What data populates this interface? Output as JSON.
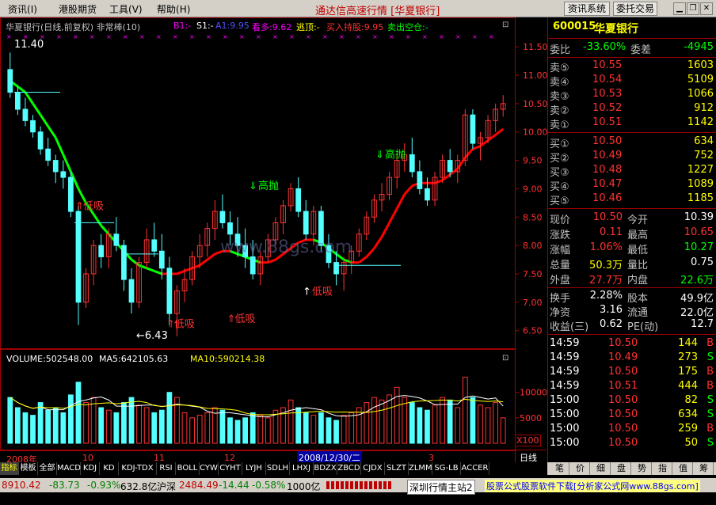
{
  "menu": {
    "items": [
      "资讯",
      "港股期货",
      "工具",
      "帮助"
    ],
    "hotkeys": [
      "(I)",
      "",
      "(V)",
      "(H)"
    ],
    "app_title": "通达信高速行情 [华夏银行]",
    "btn_news": "资讯系统",
    "btn_trade": "委托交易"
  },
  "legend": {
    "title": "华夏银行(日线,前复权) 非常棒(10)",
    "b1": "B1:-",
    "s1": "S1:-",
    "a1": "A1:9.95",
    "kd": "看多:9.62",
    "ts": "逃顶:-",
    "mrcg": "买入持股:9.95",
    "mckc": "卖出空仓:-"
  },
  "volume_legend": {
    "volume": "VOLUME:502548.00",
    "ma5": "MA5:642105.63",
    "ma10": "MA10:590214.38"
  },
  "watermark": "www.88gs.com",
  "annotations": {
    "high": "11.40",
    "low": "6.43",
    "buy": "低吸",
    "sell": "高抛"
  },
  "axis": {
    "x_labels": [
      "2008年",
      "10",
      "11",
      "12",
      "3"
    ],
    "date_box": "2008/12/30/二",
    "period": "日线",
    "vol_unit": "X100"
  },
  "stock": {
    "code": "600015",
    "name": "华夏银行"
  },
  "orderbook": {
    "ratio_label": "委比",
    "ratio": "-33.60%",
    "diff_label": "委差",
    "diff": "-4945",
    "asks": [
      {
        "label": "卖⑤",
        "price": "10.55",
        "vol": "1603"
      },
      {
        "label": "卖④",
        "price": "10.54",
        "vol": "5109"
      },
      {
        "label": "卖③",
        "price": "10.53",
        "vol": "1066"
      },
      {
        "label": "卖②",
        "price": "10.52",
        "vol": "912"
      },
      {
        "label": "卖①",
        "price": "10.51",
        "vol": "1142"
      }
    ],
    "bids": [
      {
        "label": "买①",
        "price": "10.50",
        "vol": "634"
      },
      {
        "label": "买②",
        "price": "10.49",
        "vol": "752"
      },
      {
        "label": "买③",
        "price": "10.48",
        "vol": "1227"
      },
      {
        "label": "买④",
        "price": "10.47",
        "vol": "1089"
      },
      {
        "label": "买⑤",
        "price": "10.46",
        "vol": "1185"
      }
    ]
  },
  "quote": [
    {
      "l1": "现价",
      "v1": "10.50",
      "l2": "今开",
      "v2": "10.39"
    },
    {
      "l1": "涨跌",
      "v1": "0.11",
      "l2": "最高",
      "v2": "10.65"
    },
    {
      "l1": "涨幅",
      "v1": "1.06%",
      "l2": "最低",
      "v2": "10.27"
    },
    {
      "l1": "总量",
      "v1": "50.3万",
      "l2": "量比",
      "v2": "0.75"
    },
    {
      "l1": "外盘",
      "v1": "27.7万",
      "l2": "内盘",
      "v2": "22.6万"
    }
  ],
  "fundamentals": [
    {
      "l1": "换手",
      "v1": "2.28%",
      "l2": "股本",
      "v2": "49.9亿"
    },
    {
      "l1": "净资",
      "v1": "3.16",
      "l2": "流通",
      "v2": "22.0亿"
    },
    {
      "l1": "收益(三)",
      "v1": "0.62",
      "l2": "PE(动)",
      "v2": "12.7"
    }
  ],
  "ticks": [
    {
      "time": "14:59",
      "price": "10.50",
      "vol": "144",
      "side": "B"
    },
    {
      "time": "14:59",
      "price": "10.49",
      "vol": "273",
      "side": "S"
    },
    {
      "time": "14:59",
      "price": "10.50",
      "vol": "175",
      "side": "B"
    },
    {
      "time": "14:59",
      "price": "10.51",
      "vol": "444",
      "side": "B"
    },
    {
      "time": "15:00",
      "price": "10.50",
      "vol": "82",
      "side": "S"
    },
    {
      "time": "15:00",
      "price": "10.50",
      "vol": "634",
      "side": "S"
    },
    {
      "time": "15:00",
      "price": "10.50",
      "vol": "259",
      "side": "B"
    },
    {
      "time": "15:00",
      "price": "10.50",
      "vol": "50",
      "side": "S"
    }
  ],
  "tabs": [
    "指标",
    "模板",
    "全部",
    "MACD",
    "KDJ",
    "KD",
    "KDJ-TDX",
    "RSI",
    "BOLL",
    "CYW",
    "CYHT",
    "LYJH",
    "SDLH",
    "LHXJ",
    "BDZX",
    "ZBCD",
    "CJDX",
    "SLZT",
    "ZLMM",
    "SG-LB",
    "ACCER"
  ],
  "right_tabs": [
    "笔",
    "价",
    "细",
    "盘",
    "势",
    "指",
    "值",
    "筹"
  ],
  "status": {
    "sh": "8910.42",
    "sh_chg": "-83.73",
    "sh_pct": "-0.93%",
    "sh_amt": "632.8亿",
    "sz_label": "沪深",
    "sz": "2484.49",
    "sz_chg": "-14.44",
    "sz_pct": "-0.58%",
    "sz_amt": "1000亿",
    "station": "深圳行情主站2",
    "ad": "股票公式股票软件下载[分析家公式网www.88gs.com]"
  },
  "colors": {
    "up": "#ff3232",
    "down": "#54ffff",
    "accent": "#ffff00",
    "ma": "#00ff00",
    "ma_up": "#ff0000"
  },
  "chart_data": {
    "type": "candlestick",
    "title": "华夏银行(日线,前复权) 非常棒(10)",
    "ylim": [
      6.3,
      11.6
    ],
    "y_ticks": [
      6.5,
      7.0,
      7.5,
      8.0,
      8.5,
      9.0,
      9.5,
      10.0,
      10.5,
      11.0,
      11.5
    ],
    "volume_ticks": [
      5000,
      10000
    ],
    "ohlc": [
      [
        11.1,
        11.4,
        10.6,
        10.7
      ],
      [
        10.7,
        10.8,
        10.3,
        10.4
      ],
      [
        10.4,
        10.6,
        10.1,
        10.2
      ],
      [
        10.2,
        10.3,
        9.9,
        10.0
      ],
      [
        10.0,
        10.1,
        9.6,
        9.7
      ],
      [
        9.7,
        9.9,
        9.4,
        9.5
      ],
      [
        9.5,
        9.6,
        9.1,
        9.3
      ],
      [
        9.3,
        9.5,
        9.0,
        9.2
      ],
      [
        9.2,
        9.3,
        8.5,
        8.6
      ],
      [
        8.6,
        8.7,
        6.6,
        7.0
      ],
      [
        7.0,
        7.6,
        6.9,
        7.5
      ],
      [
        7.5,
        8.1,
        7.3,
        8.0
      ],
      [
        8.0,
        8.2,
        7.6,
        7.8
      ],
      [
        7.8,
        8.3,
        7.6,
        8.2
      ],
      [
        8.2,
        8.5,
        7.9,
        8.0
      ],
      [
        8.0,
        8.1,
        7.2,
        7.4
      ],
      [
        7.4,
        7.6,
        6.8,
        7.0
      ],
      [
        7.0,
        7.8,
        6.9,
        7.7
      ],
      [
        7.7,
        8.3,
        7.6,
        8.1
      ],
      [
        8.1,
        8.4,
        7.8,
        7.9
      ],
      [
        7.9,
        8.2,
        7.4,
        7.6
      ],
      [
        7.6,
        7.8,
        6.6,
        6.8
      ],
      [
        6.8,
        7.3,
        6.4,
        7.2
      ],
      [
        7.2,
        7.6,
        7.0,
        7.4
      ],
      [
        7.4,
        7.9,
        7.3,
        7.8
      ],
      [
        7.8,
        8.2,
        7.6,
        8.0
      ],
      [
        8.0,
        8.4,
        7.8,
        8.3
      ],
      [
        8.3,
        8.8,
        8.1,
        8.6
      ],
      [
        8.6,
        8.9,
        8.3,
        8.4
      ],
      [
        8.4,
        8.6,
        8.0,
        8.2
      ],
      [
        8.2,
        8.5,
        7.8,
        8.0
      ],
      [
        8.0,
        8.3,
        7.6,
        7.8
      ],
      [
        7.8,
        8.1,
        7.4,
        7.5
      ],
      [
        7.5,
        7.9,
        7.3,
        7.8
      ],
      [
        7.8,
        8.2,
        7.7,
        8.1
      ],
      [
        8.1,
        8.5,
        8.0,
        8.4
      ],
      [
        8.4,
        8.8,
        8.2,
        8.7
      ],
      [
        8.7,
        9.1,
        8.6,
        9.0
      ],
      [
        9.0,
        9.2,
        8.5,
        8.6
      ],
      [
        8.6,
        8.8,
        8.1,
        8.2
      ],
      [
        8.2,
        8.7,
        8.0,
        8.6
      ],
      [
        8.6,
        8.7,
        7.9,
        8.0
      ],
      [
        8.0,
        8.2,
        7.6,
        7.7
      ],
      [
        7.7,
        7.9,
        7.3,
        7.5
      ],
      [
        7.5,
        7.8,
        7.2,
        7.7
      ],
      [
        7.7,
        8.0,
        7.5,
        7.9
      ],
      [
        7.9,
        8.3,
        7.8,
        8.2
      ],
      [
        8.2,
        8.6,
        8.1,
        8.5
      ],
      [
        8.5,
        8.9,
        8.4,
        8.8
      ],
      [
        8.8,
        9.1,
        8.6,
        8.9
      ],
      [
        8.9,
        9.3,
        8.8,
        9.2
      ],
      [
        9.2,
        9.6,
        9.0,
        9.5
      ],
      [
        9.5,
        9.8,
        9.3,
        9.6
      ],
      [
        9.6,
        9.9,
        9.2,
        9.3
      ],
      [
        9.3,
        9.5,
        8.9,
        9.0
      ],
      [
        9.0,
        9.2,
        8.7,
        8.8
      ],
      [
        8.8,
        9.3,
        8.7,
        9.2
      ],
      [
        9.2,
        9.6,
        9.1,
        9.5
      ],
      [
        9.5,
        9.7,
        9.2,
        9.3
      ],
      [
        9.3,
        9.6,
        9.1,
        9.5
      ],
      [
        9.5,
        10.4,
        9.4,
        10.3
      ],
      [
        10.3,
        10.4,
        9.7,
        9.8
      ],
      [
        9.8,
        10.0,
        9.5,
        9.9
      ],
      [
        9.9,
        10.3,
        9.8,
        10.2
      ],
      [
        10.2,
        10.5,
        10.0,
        10.4
      ],
      [
        10.4,
        10.65,
        10.27,
        10.5
      ]
    ],
    "ma": [
      10.9,
      10.8,
      10.7,
      10.5,
      10.3,
      10.1,
      9.9,
      9.6,
      9.3,
      9.0,
      8.75,
      8.55,
      8.35,
      8.2,
      8.05,
      7.9,
      7.75,
      7.65,
      7.6,
      7.55,
      7.5,
      7.5,
      7.5,
      7.55,
      7.6,
      7.65,
      7.75,
      7.85,
      7.9,
      7.9,
      7.85,
      7.8,
      7.75,
      7.7,
      7.7,
      7.75,
      7.85,
      7.95,
      8.05,
      8.1,
      8.1,
      8.05,
      7.95,
      7.85,
      7.75,
      7.7,
      7.7,
      7.8,
      7.95,
      8.15,
      8.4,
      8.65,
      8.9,
      9.05,
      9.1,
      9.1,
      9.1,
      9.15,
      9.25,
      9.35,
      9.55,
      9.7,
      9.75,
      9.85,
      9.95,
      10.05
    ],
    "volume": [
      9000,
      7000,
      6000,
      5500,
      8000,
      6500,
      7000,
      6000,
      9500,
      12000,
      8000,
      9000,
      7000,
      6500,
      6000,
      8000,
      9000,
      7500,
      7000,
      6000,
      6500,
      10000,
      9000,
      6000,
      5000,
      5500,
      6000,
      7000,
      6500,
      5000,
      4500,
      5000,
      6000,
      5500,
      5000,
      6500,
      7000,
      8500,
      7000,
      6000,
      5500,
      6000,
      5000,
      4500,
      5500,
      6000,
      7000,
      8000,
      9000,
      8500,
      9500,
      11000,
      9000,
      8000,
      7000,
      6500,
      7500,
      9000,
      8500,
      7000,
      13000,
      9000,
      7500,
      7000,
      8000,
      5000
    ],
    "signals_buy": [
      "低吸",
      "低吸",
      "低吸"
    ],
    "signals_sell": [
      "高抛",
      "高抛"
    ]
  }
}
